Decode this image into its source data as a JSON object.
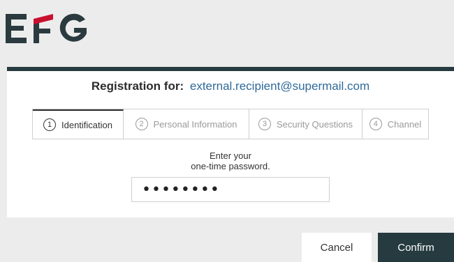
{
  "brand": {
    "logo_text": "EFG",
    "logo_dark": "#2b3a3e",
    "logo_accent": "#c8102e"
  },
  "registration": {
    "label": "Registration for:",
    "email": "external.recipient@supermail.com"
  },
  "steps": [
    {
      "num": "1",
      "label": "Identification",
      "active": true
    },
    {
      "num": "2",
      "label": "Personal Information",
      "active": false
    },
    {
      "num": "3",
      "label": "Security Questions",
      "active": false
    },
    {
      "num": "4",
      "label": "Channel",
      "active": false
    }
  ],
  "form": {
    "prompt_line1": "Enter your",
    "prompt_line2": "one-time password.",
    "password_value": "••••••••"
  },
  "buttons": {
    "cancel": "Cancel",
    "confirm": "Confirm"
  },
  "colors": {
    "header_bar": "#263b3f",
    "email_link": "#2f6a9a"
  }
}
